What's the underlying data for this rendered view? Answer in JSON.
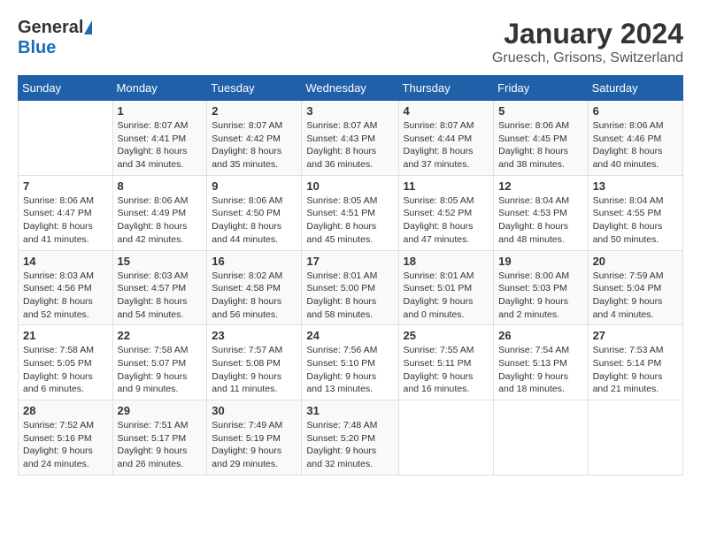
{
  "header": {
    "logo_general": "General",
    "logo_blue": "Blue",
    "month_year": "January 2024",
    "location": "Gruesch, Grisons, Switzerland"
  },
  "weekdays": [
    "Sunday",
    "Monday",
    "Tuesday",
    "Wednesday",
    "Thursday",
    "Friday",
    "Saturday"
  ],
  "weeks": [
    [
      {
        "num": "",
        "detail": ""
      },
      {
        "num": "1",
        "detail": "Sunrise: 8:07 AM\nSunset: 4:41 PM\nDaylight: 8 hours\nand 34 minutes."
      },
      {
        "num": "2",
        "detail": "Sunrise: 8:07 AM\nSunset: 4:42 PM\nDaylight: 8 hours\nand 35 minutes."
      },
      {
        "num": "3",
        "detail": "Sunrise: 8:07 AM\nSunset: 4:43 PM\nDaylight: 8 hours\nand 36 minutes."
      },
      {
        "num": "4",
        "detail": "Sunrise: 8:07 AM\nSunset: 4:44 PM\nDaylight: 8 hours\nand 37 minutes."
      },
      {
        "num": "5",
        "detail": "Sunrise: 8:06 AM\nSunset: 4:45 PM\nDaylight: 8 hours\nand 38 minutes."
      },
      {
        "num": "6",
        "detail": "Sunrise: 8:06 AM\nSunset: 4:46 PM\nDaylight: 8 hours\nand 40 minutes."
      }
    ],
    [
      {
        "num": "7",
        "detail": "Sunrise: 8:06 AM\nSunset: 4:47 PM\nDaylight: 8 hours\nand 41 minutes."
      },
      {
        "num": "8",
        "detail": "Sunrise: 8:06 AM\nSunset: 4:49 PM\nDaylight: 8 hours\nand 42 minutes."
      },
      {
        "num": "9",
        "detail": "Sunrise: 8:06 AM\nSunset: 4:50 PM\nDaylight: 8 hours\nand 44 minutes."
      },
      {
        "num": "10",
        "detail": "Sunrise: 8:05 AM\nSunset: 4:51 PM\nDaylight: 8 hours\nand 45 minutes."
      },
      {
        "num": "11",
        "detail": "Sunrise: 8:05 AM\nSunset: 4:52 PM\nDaylight: 8 hours\nand 47 minutes."
      },
      {
        "num": "12",
        "detail": "Sunrise: 8:04 AM\nSunset: 4:53 PM\nDaylight: 8 hours\nand 48 minutes."
      },
      {
        "num": "13",
        "detail": "Sunrise: 8:04 AM\nSunset: 4:55 PM\nDaylight: 8 hours\nand 50 minutes."
      }
    ],
    [
      {
        "num": "14",
        "detail": "Sunrise: 8:03 AM\nSunset: 4:56 PM\nDaylight: 8 hours\nand 52 minutes."
      },
      {
        "num": "15",
        "detail": "Sunrise: 8:03 AM\nSunset: 4:57 PM\nDaylight: 8 hours\nand 54 minutes."
      },
      {
        "num": "16",
        "detail": "Sunrise: 8:02 AM\nSunset: 4:58 PM\nDaylight: 8 hours\nand 56 minutes."
      },
      {
        "num": "17",
        "detail": "Sunrise: 8:01 AM\nSunset: 5:00 PM\nDaylight: 8 hours\nand 58 minutes."
      },
      {
        "num": "18",
        "detail": "Sunrise: 8:01 AM\nSunset: 5:01 PM\nDaylight: 9 hours\nand 0 minutes."
      },
      {
        "num": "19",
        "detail": "Sunrise: 8:00 AM\nSunset: 5:03 PM\nDaylight: 9 hours\nand 2 minutes."
      },
      {
        "num": "20",
        "detail": "Sunrise: 7:59 AM\nSunset: 5:04 PM\nDaylight: 9 hours\nand 4 minutes."
      }
    ],
    [
      {
        "num": "21",
        "detail": "Sunrise: 7:58 AM\nSunset: 5:05 PM\nDaylight: 9 hours\nand 6 minutes."
      },
      {
        "num": "22",
        "detail": "Sunrise: 7:58 AM\nSunset: 5:07 PM\nDaylight: 9 hours\nand 9 minutes."
      },
      {
        "num": "23",
        "detail": "Sunrise: 7:57 AM\nSunset: 5:08 PM\nDaylight: 9 hours\nand 11 minutes."
      },
      {
        "num": "24",
        "detail": "Sunrise: 7:56 AM\nSunset: 5:10 PM\nDaylight: 9 hours\nand 13 minutes."
      },
      {
        "num": "25",
        "detail": "Sunrise: 7:55 AM\nSunset: 5:11 PM\nDaylight: 9 hours\nand 16 minutes."
      },
      {
        "num": "26",
        "detail": "Sunrise: 7:54 AM\nSunset: 5:13 PM\nDaylight: 9 hours\nand 18 minutes."
      },
      {
        "num": "27",
        "detail": "Sunrise: 7:53 AM\nSunset: 5:14 PM\nDaylight: 9 hours\nand 21 minutes."
      }
    ],
    [
      {
        "num": "28",
        "detail": "Sunrise: 7:52 AM\nSunset: 5:16 PM\nDaylight: 9 hours\nand 24 minutes."
      },
      {
        "num": "29",
        "detail": "Sunrise: 7:51 AM\nSunset: 5:17 PM\nDaylight: 9 hours\nand 26 minutes."
      },
      {
        "num": "30",
        "detail": "Sunrise: 7:49 AM\nSunset: 5:19 PM\nDaylight: 9 hours\nand 29 minutes."
      },
      {
        "num": "31",
        "detail": "Sunrise: 7:48 AM\nSunset: 5:20 PM\nDaylight: 9 hours\nand 32 minutes."
      },
      {
        "num": "",
        "detail": ""
      },
      {
        "num": "",
        "detail": ""
      },
      {
        "num": "",
        "detail": ""
      }
    ]
  ]
}
